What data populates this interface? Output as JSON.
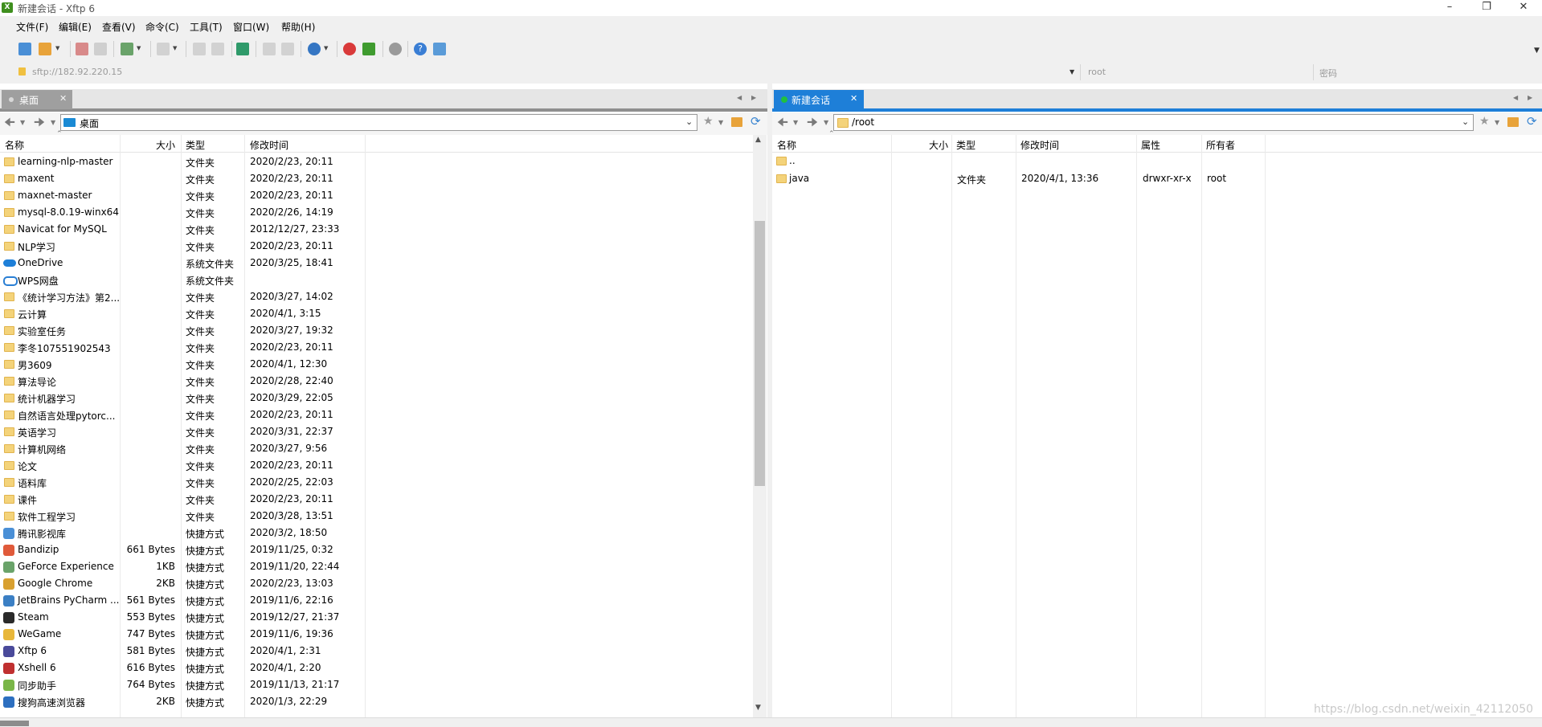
{
  "window": {
    "title": "新建会话 - Xftp 6",
    "icon_text": "X"
  },
  "menu": [
    "文件(F)",
    "编辑(E)",
    "查看(V)",
    "命令(C)",
    "工具(T)",
    "窗口(W)",
    "帮助(H)"
  ],
  "address": {
    "value": "sftp://182.92.220.15",
    "user_placeholder": "root",
    "password_placeholder": "密码"
  },
  "left": {
    "tab_label": "桌面",
    "path": "桌面",
    "columns": [
      "名称",
      "大小",
      "类型",
      "修改时间"
    ],
    "rows": [
      {
        "name": "learning-nlp-master",
        "size": "",
        "type": "文件夹",
        "modified": "2020/2/23, 20:11",
        "icon": "folder"
      },
      {
        "name": "maxent",
        "size": "",
        "type": "文件夹",
        "modified": "2020/2/23, 20:11",
        "icon": "folder"
      },
      {
        "name": "maxnet-master",
        "size": "",
        "type": "文件夹",
        "modified": "2020/2/23, 20:11",
        "icon": "folder"
      },
      {
        "name": "mysql-8.0.19-winx64",
        "size": "",
        "type": "文件夹",
        "modified": "2020/2/26, 14:19",
        "icon": "folder"
      },
      {
        "name": "Navicat for MySQL",
        "size": "",
        "type": "文件夹",
        "modified": "2012/12/27, 23:33",
        "icon": "folder"
      },
      {
        "name": "NLP学习",
        "size": "",
        "type": "文件夹",
        "modified": "2020/2/23, 20:11",
        "icon": "folder"
      },
      {
        "name": "OneDrive",
        "size": "",
        "type": "系统文件夹",
        "modified": "2020/3/25, 18:41",
        "icon": "cloud"
      },
      {
        "name": "WPS网盘",
        "size": "",
        "type": "系统文件夹",
        "modified": "",
        "icon": "cloud-outline"
      },
      {
        "name": "《统计学习方法》第2...",
        "size": "",
        "type": "文件夹",
        "modified": "2020/3/27, 14:02",
        "icon": "folder"
      },
      {
        "name": "云计算",
        "size": "",
        "type": "文件夹",
        "modified": "2020/4/1, 3:15",
        "icon": "folder"
      },
      {
        "name": "实验室任务",
        "size": "",
        "type": "文件夹",
        "modified": "2020/3/27, 19:32",
        "icon": "folder"
      },
      {
        "name": "李冬107551902543",
        "size": "",
        "type": "文件夹",
        "modified": "2020/2/23, 20:11",
        "icon": "folder"
      },
      {
        "name": "男3609",
        "size": "",
        "type": "文件夹",
        "modified": "2020/4/1, 12:30",
        "icon": "folder"
      },
      {
        "name": "算法导论",
        "size": "",
        "type": "文件夹",
        "modified": "2020/2/28, 22:40",
        "icon": "folder"
      },
      {
        "name": "统计机器学习",
        "size": "",
        "type": "文件夹",
        "modified": "2020/3/29, 22:05",
        "icon": "folder"
      },
      {
        "name": "自然语言处理pytorc...",
        "size": "",
        "type": "文件夹",
        "modified": "2020/2/23, 20:11",
        "icon": "folder"
      },
      {
        "name": "英语学习",
        "size": "",
        "type": "文件夹",
        "modified": "2020/3/31, 22:37",
        "icon": "folder"
      },
      {
        "name": "计算机网络",
        "size": "",
        "type": "文件夹",
        "modified": "2020/3/27, 9:56",
        "icon": "folder"
      },
      {
        "name": "论文",
        "size": "",
        "type": "文件夹",
        "modified": "2020/2/23, 20:11",
        "icon": "folder"
      },
      {
        "name": "语料库",
        "size": "",
        "type": "文件夹",
        "modified": "2020/2/25, 22:03",
        "icon": "folder"
      },
      {
        "name": "课件",
        "size": "",
        "type": "文件夹",
        "modified": "2020/2/23, 20:11",
        "icon": "folder"
      },
      {
        "name": "软件工程学习",
        "size": "",
        "type": "文件夹",
        "modified": "2020/3/28, 13:51",
        "icon": "folder"
      },
      {
        "name": "腾讯影视库",
        "size": "",
        "type": "快捷方式",
        "modified": "2020/3/2, 18:50",
        "icon": "shortcut"
      },
      {
        "name": "Bandizip",
        "size": "661 Bytes",
        "type": "快捷方式",
        "modified": "2019/11/25, 0:32",
        "icon": "shortcut"
      },
      {
        "name": "GeForce Experience",
        "size": "1KB",
        "type": "快捷方式",
        "modified": "2019/11/20, 22:44",
        "icon": "shortcut"
      },
      {
        "name": "Google Chrome",
        "size": "2KB",
        "type": "快捷方式",
        "modified": "2020/2/23, 13:03",
        "icon": "shortcut"
      },
      {
        "name": "JetBrains PyCharm ...",
        "size": "561 Bytes",
        "type": "快捷方式",
        "modified": "2019/11/6, 22:16",
        "icon": "shortcut"
      },
      {
        "name": "Steam",
        "size": "553 Bytes",
        "type": "快捷方式",
        "modified": "2019/12/27, 21:37",
        "icon": "shortcut"
      },
      {
        "name": "WeGame",
        "size": "747 Bytes",
        "type": "快捷方式",
        "modified": "2019/11/6, 19:36",
        "icon": "shortcut"
      },
      {
        "name": "Xftp 6",
        "size": "581 Bytes",
        "type": "快捷方式",
        "modified": "2020/4/1, 2:31",
        "icon": "shortcut"
      },
      {
        "name": "Xshell 6",
        "size": "616 Bytes",
        "type": "快捷方式",
        "modified": "2020/4/1, 2:20",
        "icon": "shortcut"
      },
      {
        "name": "同步助手",
        "size": "764 Bytes",
        "type": "快捷方式",
        "modified": "2019/11/13, 21:17",
        "icon": "shortcut"
      },
      {
        "name": "搜狗高速浏览器",
        "size": "2KB",
        "type": "快捷方式",
        "modified": "2020/1/3, 22:29",
        "icon": "shortcut"
      }
    ]
  },
  "right": {
    "tab_label": "新建会话",
    "path": "/root",
    "columns": [
      "名称",
      "大小",
      "类型",
      "修改时间",
      "属性",
      "所有者"
    ],
    "rows": [
      {
        "name": "..",
        "size": "",
        "type": "",
        "modified": "",
        "attrs": "",
        "owner": ""
      },
      {
        "name": "java",
        "size": "",
        "type": "文件夹",
        "modified": "2020/4/1, 13:36",
        "attrs": "drwxr-xr-x",
        "owner": "root"
      }
    ]
  },
  "watermark": "https://blog.csdn.net/weixin_42112050",
  "colors": {
    "accent": "#0078d7",
    "folder": "#f4d37a",
    "tab_active": "#1e7fd8"
  }
}
